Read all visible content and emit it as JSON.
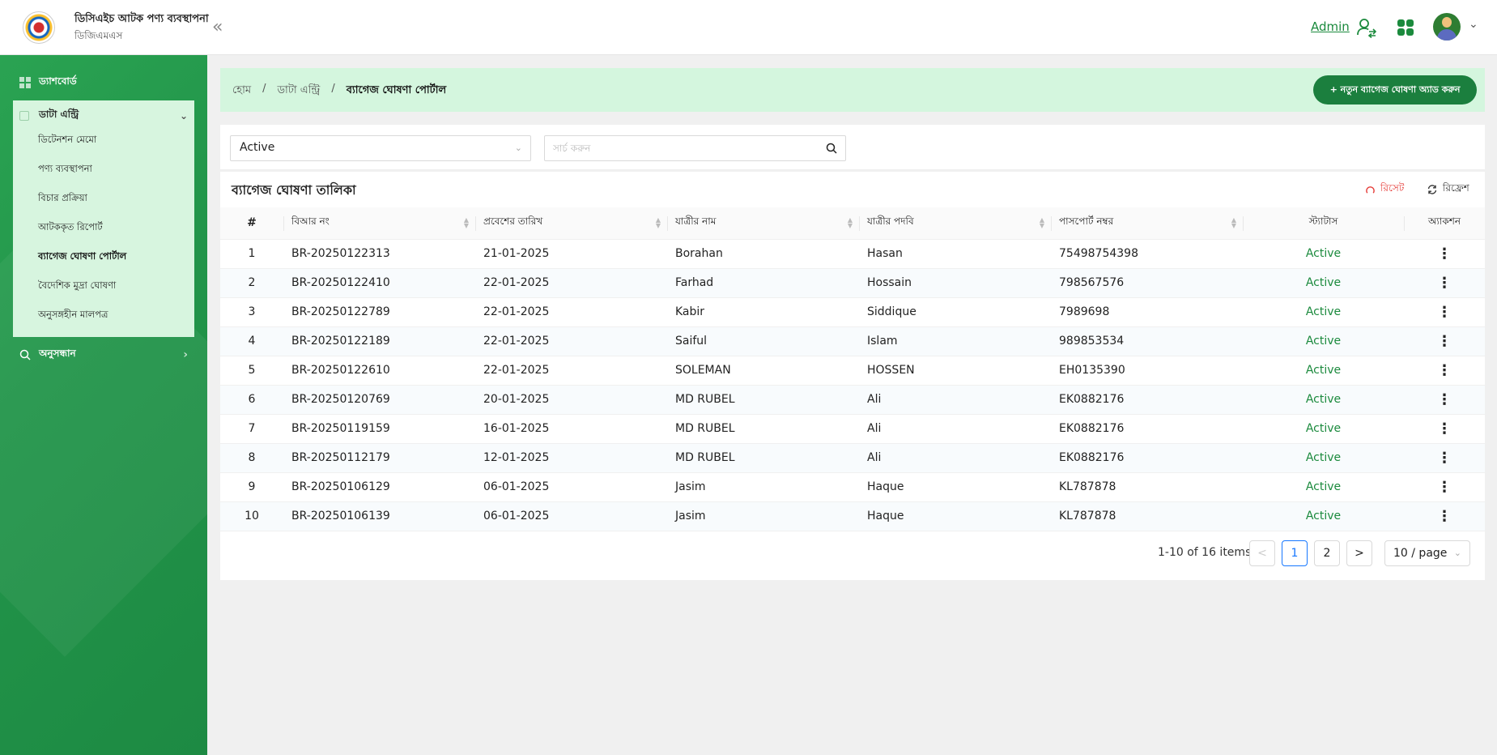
{
  "header": {
    "app_title": "ডিসিএইচ আটক পণ্য ব্যবস্থাপনা",
    "app_subtitle": "ডিজিএমএস",
    "collapse_icon": "double-chevron-left",
    "user_name": "Admin",
    "accent": "#1b8a3d"
  },
  "sidebar": {
    "dashboard_label": "ড্যাশবোর্ড",
    "data_entry_label": "ডাটা এন্ট্রি",
    "sub_items": [
      {
        "label": "ডিটেনশন মেমো",
        "active": false
      },
      {
        "label": "পণ্য ব্যবস্থাপনা",
        "active": false
      },
      {
        "label": "বিচার প্রক্রিয়া",
        "active": false
      },
      {
        "label": "আটককৃত রিপোর্ট",
        "active": false
      },
      {
        "label": "ব্যাগেজ ঘোষণা পোর্টাল",
        "active": true
      },
      {
        "label": "বৈদেশিক মুদ্রা ঘোষণা",
        "active": false
      },
      {
        "label": "অনুসঙ্গহীন মালপত্র",
        "active": false
      }
    ],
    "search_label": "অনুসন্ধান"
  },
  "breadcrumb": {
    "home": "হোম",
    "sep": "/",
    "data_entry": "ডাটা এন্ট্রি",
    "current": "ব্যাগেজ ঘোষণা পোর্টাল"
  },
  "add_button_label": "+ নতুন ব্যাগেজ ঘোষণা অ্যাড করুন",
  "filters": {
    "status_value": "Active",
    "search_placeholder": "সার্চ করুন"
  },
  "table": {
    "title": "ব্যাগেজ ঘোষণা তালিকা",
    "reset_label": "রিসেট",
    "refresh_label": "রিফ্রেশ",
    "columns": [
      "#",
      "বিআর নং",
      "প্রবেশের তারিখ",
      "যাত্রীর নাম",
      "যাত্রীর পদবি",
      "পাসপোর্ট নম্বর",
      "স্ট্যাটাস",
      "অ্যাকশন"
    ],
    "rows": [
      {
        "n": "1",
        "br": "BR-20250122313",
        "date": "21-01-2025",
        "name": "Borahan",
        "title": "Hasan",
        "passport": "75498754398",
        "status": "Active"
      },
      {
        "n": "2",
        "br": "BR-20250122410",
        "date": "22-01-2025",
        "name": "Farhad",
        "title": "Hossain",
        "passport": "798567576",
        "status": "Active"
      },
      {
        "n": "3",
        "br": "BR-20250122789",
        "date": "22-01-2025",
        "name": "Kabir",
        "title": "Siddique",
        "passport": "7989698",
        "status": "Active"
      },
      {
        "n": "4",
        "br": "BR-20250122189",
        "date": "22-01-2025",
        "name": "Saiful",
        "title": "Islam",
        "passport": "989853534",
        "status": "Active"
      },
      {
        "n": "5",
        "br": "BR-20250122610",
        "date": "22-01-2025",
        "name": "SOLEMAN",
        "title": "HOSSEN",
        "passport": "EH0135390",
        "status": "Active"
      },
      {
        "n": "6",
        "br": "BR-20250120769",
        "date": "20-01-2025",
        "name": "MD RUBEL",
        "title": "Ali",
        "passport": "EK0882176",
        "status": "Active"
      },
      {
        "n": "7",
        "br": "BR-20250119159",
        "date": "16-01-2025",
        "name": "MD RUBEL",
        "title": "Ali",
        "passport": "EK0882176",
        "status": "Active"
      },
      {
        "n": "8",
        "br": "BR-20250112179",
        "date": "12-01-2025",
        "name": "MD RUBEL",
        "title": "Ali",
        "passport": "EK0882176",
        "status": "Active"
      },
      {
        "n": "9",
        "br": "BR-20250106129",
        "date": "06-01-2025",
        "name": "Jasim",
        "title": "Haque",
        "passport": "KL787878",
        "status": "Active"
      },
      {
        "n": "10",
        "br": "BR-20250106139",
        "date": "06-01-2025",
        "name": "Jasim",
        "title": "Haque",
        "passport": "KL787878",
        "status": "Active"
      }
    ]
  },
  "pagination": {
    "total_text": "1-10 of 16 items",
    "prev": "<",
    "pages": [
      "1",
      "2"
    ],
    "current_page": "1",
    "next": ">",
    "page_size": "10 / page"
  }
}
